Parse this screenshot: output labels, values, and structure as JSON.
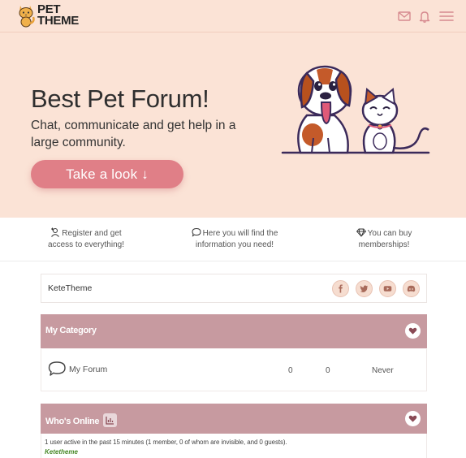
{
  "header": {
    "logo_line1": "PET",
    "logo_line2": "THEME",
    "icons": [
      "mail-icon",
      "bell-icon",
      "menu-icon"
    ]
  },
  "hero": {
    "title": "Best Pet Forum!",
    "subtitle": "Chat, communicate and get help in a large community.",
    "cta_label": "Take a look ↓"
  },
  "features": [
    {
      "icon": "add-user-icon",
      "line1": "Register and get",
      "line2": "access to everything!"
    },
    {
      "icon": "chat-bubble-icon",
      "line1": "Here you will find the",
      "line2": "information you need!"
    },
    {
      "icon": "diamond-icon",
      "line1": "You can buy",
      "line2": "memberships!"
    }
  ],
  "sitebar": {
    "name": "KeteTheme",
    "social": [
      "facebook-icon",
      "twitter-icon",
      "youtube-icon",
      "discord-icon"
    ]
  },
  "category": {
    "title": "My Category",
    "forums": [
      {
        "name": "My Forum",
        "topics": "0",
        "posts": "0",
        "last_post": "Never"
      }
    ]
  },
  "whos_online": {
    "title": "Who's Online",
    "summary": "1 user active in the past 15 minutes (1 member, 0 of whom are invisible, and 0 guests).",
    "users": "Ketetheme"
  },
  "colors": {
    "header_bg": "#fbe3d6",
    "cta": "#e07f87",
    "category_header": "#c79aa0",
    "online_user": "#4a8a2a"
  }
}
